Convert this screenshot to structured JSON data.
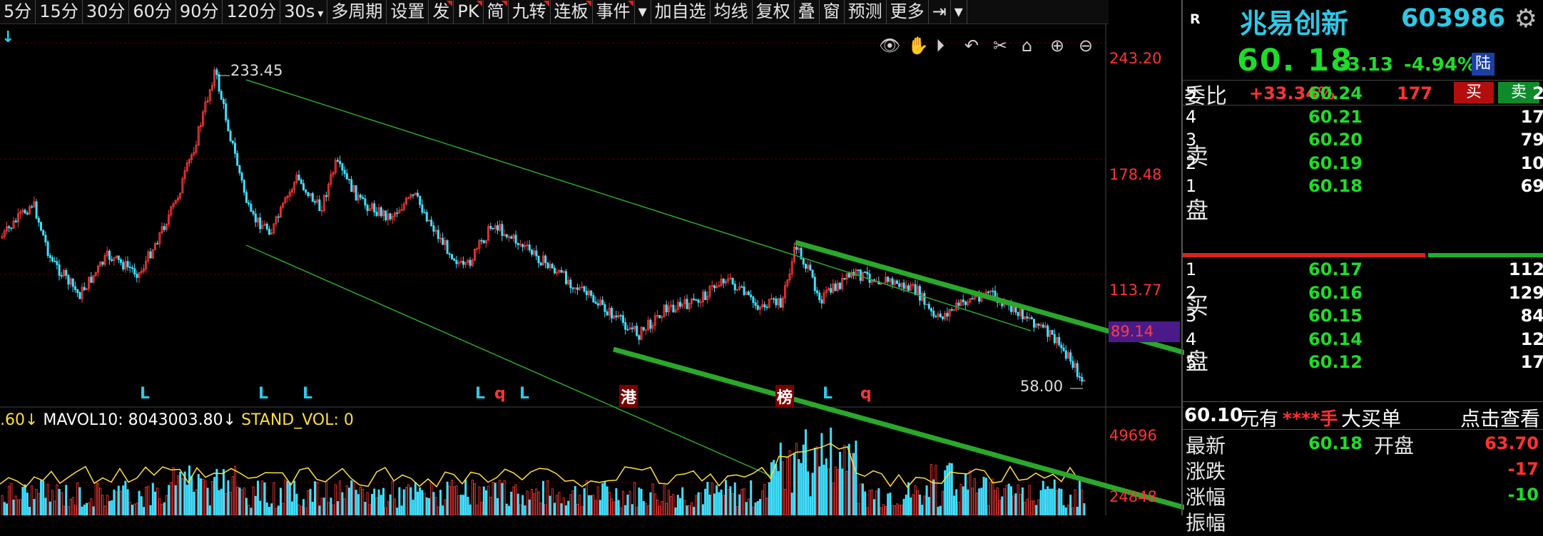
{
  "toolbar": {
    "items": [
      {
        "label": "5分"
      },
      {
        "label": "15分"
      },
      {
        "label": "30分"
      },
      {
        "label": "60分"
      },
      {
        "label": "90分"
      },
      {
        "label": "120分"
      },
      {
        "label": "30s",
        "dropdown": true
      },
      {
        "label": "多周期"
      },
      {
        "label": "设置"
      },
      {
        "label": "发",
        "red": true
      },
      {
        "label": "PK",
        "red": true
      },
      {
        "label": "简",
        "red": true
      },
      {
        "label": "九转",
        "red": true
      },
      {
        "label": "连板",
        "red": true
      },
      {
        "label": "事件",
        "red": true
      },
      {
        "label": "▾"
      },
      {
        "label": "加自选"
      },
      {
        "label": "均线"
      },
      {
        "label": "复权"
      },
      {
        "label": "叠"
      },
      {
        "label": "窗"
      },
      {
        "label": "预测"
      },
      {
        "label": "更多"
      },
      {
        "label": "⇥"
      },
      {
        "label": "▾"
      }
    ]
  },
  "chart": {
    "price_axis": [
      "243.20",
      "178.48",
      "113.77"
    ],
    "current_tag": "89.14",
    "peak_label": "233.45",
    "low_label": "58.00",
    "volume_axis": [
      "49696",
      "24848"
    ],
    "volume_header": {
      "prefix": ".60↓",
      "mavol": "MAVOL10: 8043003.80↓",
      "stand": "STAND_VOL: 0"
    },
    "signals": [
      {
        "text": "L",
        "color": "#2ec8e6"
      },
      {
        "text": "L",
        "color": "#2ec8e6"
      },
      {
        "text": "L",
        "color": "#2ec8e6"
      },
      {
        "text": "L",
        "color": "#2ec8e6"
      },
      {
        "text": "q",
        "color": "#ff3333"
      },
      {
        "text": "L",
        "color": "#2ec8e6"
      },
      {
        "text": "港",
        "color": "#ffffff"
      },
      {
        "text": "榜",
        "color": "#ffffff"
      },
      {
        "text": "L",
        "color": "#2ec8e6"
      },
      {
        "text": "q",
        "color": "#ff3333"
      }
    ],
    "left_marker": "↓",
    "tools": [
      "eye-icon",
      "hand-icon",
      "play-icon",
      "undo-icon",
      "scissors-icon",
      "lock-icon",
      "zoom-in-icon",
      "zoom-out-icon"
    ],
    "colors": {
      "up": "#ff3a3a",
      "down": "#3fe0ff",
      "channel": "#2aa82a",
      "grid": "#5a0000"
    }
  },
  "panel": {
    "badge": "R",
    "name": "兆易创新",
    "code": "603986",
    "price": "60. 18",
    "change": "-3.13",
    "change_pct": "-4.94%",
    "market": "陆",
    "weibi": {
      "label": "委比",
      "pct": "+33.34%",
      "diff": "177",
      "buy": "买",
      "sell": "卖"
    },
    "sell_label_1": "卖",
    "sell_label_2": "盘",
    "buy_label_1": "买",
    "buy_label_2": "盘",
    "asks": [
      {
        "level": "5",
        "price": "60.24",
        "qty": "2"
      },
      {
        "level": "4",
        "price": "60.21",
        "qty": "17"
      },
      {
        "level": "3",
        "price": "60.20",
        "qty": "79"
      },
      {
        "level": "2",
        "price": "60.19",
        "qty": "10"
      },
      {
        "level": "1",
        "price": "60.18",
        "qty": "69"
      }
    ],
    "bids": [
      {
        "level": "1",
        "price": "60.17",
        "qty": "112"
      },
      {
        "level": "2",
        "price": "60.16",
        "qty": "129"
      },
      {
        "level": "3",
        "price": "60.15",
        "qty": "84"
      },
      {
        "level": "4",
        "price": "60.14",
        "qty": "12"
      },
      {
        "level": "5",
        "price": "60.12",
        "qty": "17"
      }
    ],
    "bigorder": {
      "price": "60.10",
      "have": "元有",
      "stars": "****手",
      "text": "大买单",
      "link": "点击查看"
    },
    "stats": [
      {
        "label": "最新",
        "value": "60.18",
        "label2": "开盘",
        "value2": "63.70"
      },
      {
        "label": "涨跌",
        "value": "",
        "label2": "",
        "value2": "-17"
      },
      {
        "label": "涨幅",
        "value": "",
        "label2": "",
        "value2": "-10"
      },
      {
        "label": "振幅",
        "value": "",
        "label2": "",
        "value2": ""
      }
    ]
  }
}
